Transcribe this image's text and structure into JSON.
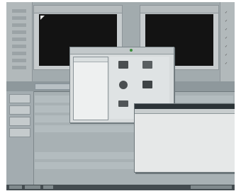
{
  "video": {
    "viewer_title": "",
    "canvas_title": ""
  },
  "dialog_small": {
    "list_header": "",
    "icons": [
      {
        "name": "keyboard-icon",
        "caption": ""
      },
      {
        "name": "bars-icon",
        "caption": ""
      },
      {
        "name": "sphere-icon",
        "caption": ""
      },
      {
        "name": "sliders-icon",
        "caption": ""
      },
      {
        "name": "text-icon",
        "caption": ""
      }
    ]
  },
  "dialog_large": {
    "title": "",
    "columns": [
      "",
      "",
      ""
    ],
    "rows": [
      {
        "c1": "",
        "c2": ""
      }
    ]
  },
  "colors": {
    "desktop": "#9aa4a8",
    "video_black": "#131313",
    "title_dark": "#2c3438",
    "indicator_green": "#3c8e3c"
  }
}
